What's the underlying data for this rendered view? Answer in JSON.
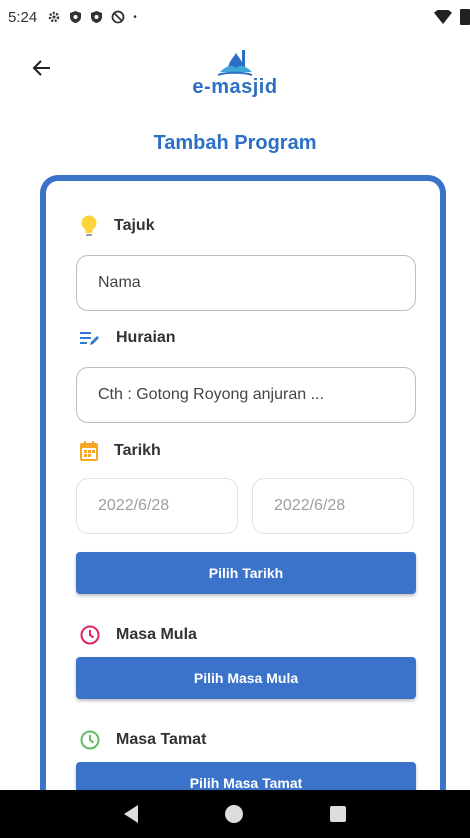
{
  "status_bar": {
    "time": "5:24"
  },
  "header": {
    "logo_text": "e-masjid",
    "title": "Tambah Program"
  },
  "form": {
    "tajuk": {
      "label": "Tajuk",
      "placeholder": "Nama"
    },
    "huraian": {
      "label": "Huraian",
      "placeholder": "Cth : Gotong Royong anjuran ..."
    },
    "tarikh": {
      "label": "Tarikh",
      "start_date": "2022/6/28",
      "end_date": "2022/6/28",
      "button_label": "Pilih Tarikh"
    },
    "masa_mula": {
      "label": "Masa Mula",
      "button_label": "Pilih Masa Mula"
    },
    "masa_tamat": {
      "label": "Masa Tamat",
      "button_label": "Pilih Masa Tamat"
    }
  },
  "colors": {
    "primary": "#3A73C9",
    "bulb": "#FFD43B",
    "edit": "#2E7BD6",
    "calendar": "#F5A623",
    "clock_start": "#E0245E",
    "clock_end": "#66BB6A"
  }
}
